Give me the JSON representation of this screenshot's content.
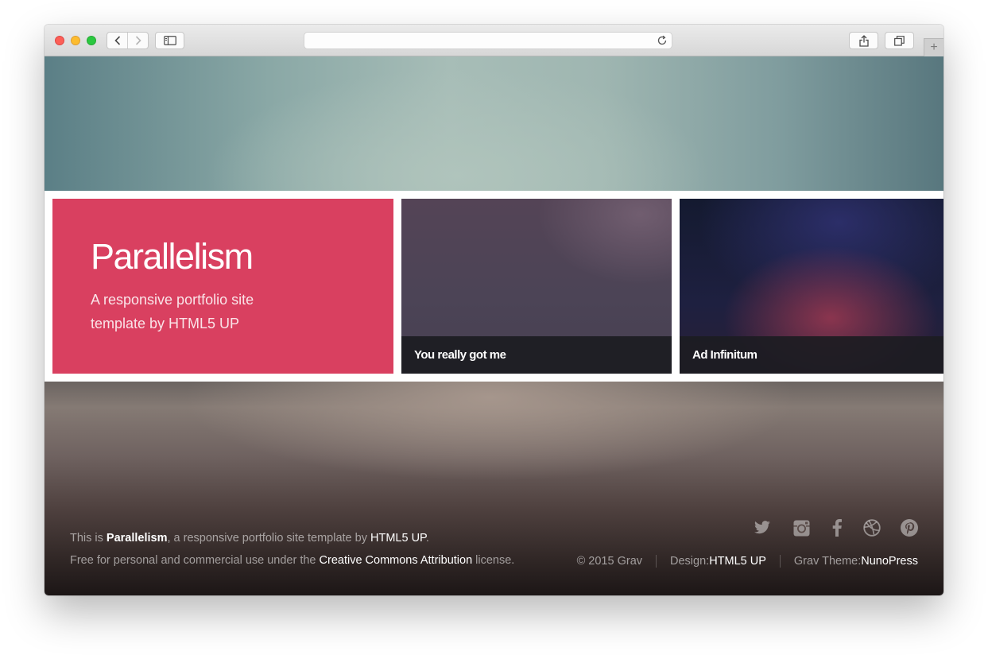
{
  "browser": {
    "url_value": "",
    "new_tab_symbol": "+"
  },
  "intro": {
    "title": "Parallelism",
    "subtitle": "A responsive portfolio site template by HTML5 UP",
    "accent_color": "#d94060"
  },
  "work_items": [
    {
      "label": "You really got me"
    },
    {
      "label": "Ad Infinitum"
    }
  ],
  "footer": {
    "line1": {
      "prefix": "This is ",
      "site_name": "Parallelism",
      "middle": ", a responsive portfolio site template by ",
      "author_link": "HTML5 UP",
      "suffix": "."
    },
    "line2": {
      "prefix": "Free for personal and commercial use under the ",
      "license_link": "Creative Commons Attribution",
      "suffix": " license."
    },
    "copyright": "© 2015 Grav",
    "design_label": "Design: ",
    "design_link": "HTML5 UP",
    "theme_label": "Grav Theme: ",
    "theme_link": "NunoPress",
    "social_icons": [
      "twitter-icon",
      "instagram-icon",
      "facebook-icon",
      "dribbble-icon",
      "pinterest-icon"
    ]
  }
}
